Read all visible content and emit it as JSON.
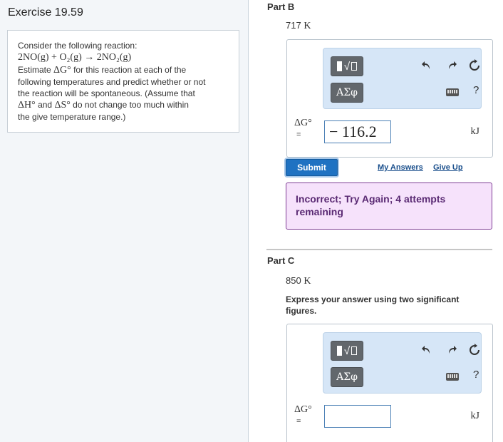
{
  "exercise": {
    "title": "Exercise 19.59"
  },
  "problem": {
    "line1": "Consider the following reaction:",
    "equation": "2NO(g) + O₂(g) → 2NO₂(g)",
    "line3_pre": "Estimate",
    "line3_sym": "ΔG°",
    "line3_post": "for this reaction at each of the",
    "line4": "following temperatures and predict whether or not",
    "line5": "the reaction will be spontaneous. (Assume that",
    "line6_sym1": "ΔH°",
    "line6_mid": "and",
    "line6_sym2": "ΔS°",
    "line6_post": "do not change too much within",
    "line7": "the give temperature range.)"
  },
  "toolbar": {
    "math_label": "√",
    "greek_label": "ΑΣφ",
    "undo_icon": "undo-arrow-icon",
    "redo_icon": "redo-arrow-icon",
    "reset_icon": "reset-icon",
    "keyboard_icon": "keyboard-icon",
    "help_label": "?"
  },
  "partB": {
    "label": "Part B",
    "temperature": "717",
    "unit_k": "K",
    "quantity": "ΔG°",
    "equals": "=",
    "answer": "− 116.2",
    "unit": "kJ",
    "submit_label": "Submit",
    "my_answers_label": "My Answers",
    "give_up_label": "Give Up",
    "feedback": "Incorrect; Try Again; 4 attempts remaining"
  },
  "partC": {
    "label": "Part C",
    "temperature": "850",
    "unit_k": "K",
    "instructions": "Express your answer using two significant figures.",
    "quantity": "ΔG°",
    "equals": "=",
    "answer": "",
    "unit": "kJ"
  }
}
